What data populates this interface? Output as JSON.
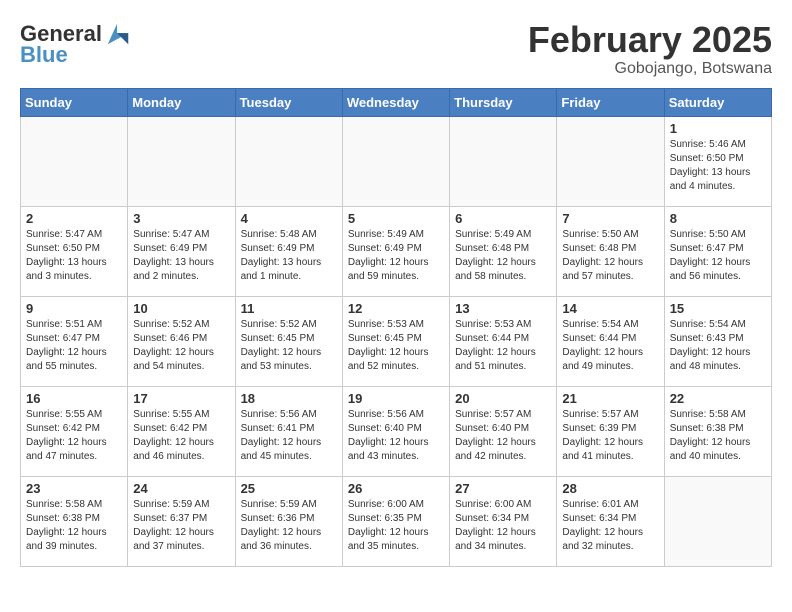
{
  "header": {
    "logo_general": "General",
    "logo_blue": "Blue",
    "month_title": "February 2025",
    "location": "Gobojango, Botswana"
  },
  "weekdays": [
    "Sunday",
    "Monday",
    "Tuesday",
    "Wednesday",
    "Thursday",
    "Friday",
    "Saturday"
  ],
  "weeks": [
    [
      {
        "day": "",
        "info": ""
      },
      {
        "day": "",
        "info": ""
      },
      {
        "day": "",
        "info": ""
      },
      {
        "day": "",
        "info": ""
      },
      {
        "day": "",
        "info": ""
      },
      {
        "day": "",
        "info": ""
      },
      {
        "day": "1",
        "info": "Sunrise: 5:46 AM\nSunset: 6:50 PM\nDaylight: 13 hours and 4 minutes."
      }
    ],
    [
      {
        "day": "2",
        "info": "Sunrise: 5:47 AM\nSunset: 6:50 PM\nDaylight: 13 hours and 3 minutes."
      },
      {
        "day": "3",
        "info": "Sunrise: 5:47 AM\nSunset: 6:49 PM\nDaylight: 13 hours and 2 minutes."
      },
      {
        "day": "4",
        "info": "Sunrise: 5:48 AM\nSunset: 6:49 PM\nDaylight: 13 hours and 1 minute."
      },
      {
        "day": "5",
        "info": "Sunrise: 5:49 AM\nSunset: 6:49 PM\nDaylight: 12 hours and 59 minutes."
      },
      {
        "day": "6",
        "info": "Sunrise: 5:49 AM\nSunset: 6:48 PM\nDaylight: 12 hours and 58 minutes."
      },
      {
        "day": "7",
        "info": "Sunrise: 5:50 AM\nSunset: 6:48 PM\nDaylight: 12 hours and 57 minutes."
      },
      {
        "day": "8",
        "info": "Sunrise: 5:50 AM\nSunset: 6:47 PM\nDaylight: 12 hours and 56 minutes."
      }
    ],
    [
      {
        "day": "9",
        "info": "Sunrise: 5:51 AM\nSunset: 6:47 PM\nDaylight: 12 hours and 55 minutes."
      },
      {
        "day": "10",
        "info": "Sunrise: 5:52 AM\nSunset: 6:46 PM\nDaylight: 12 hours and 54 minutes."
      },
      {
        "day": "11",
        "info": "Sunrise: 5:52 AM\nSunset: 6:45 PM\nDaylight: 12 hours and 53 minutes."
      },
      {
        "day": "12",
        "info": "Sunrise: 5:53 AM\nSunset: 6:45 PM\nDaylight: 12 hours and 52 minutes."
      },
      {
        "day": "13",
        "info": "Sunrise: 5:53 AM\nSunset: 6:44 PM\nDaylight: 12 hours and 51 minutes."
      },
      {
        "day": "14",
        "info": "Sunrise: 5:54 AM\nSunset: 6:44 PM\nDaylight: 12 hours and 49 minutes."
      },
      {
        "day": "15",
        "info": "Sunrise: 5:54 AM\nSunset: 6:43 PM\nDaylight: 12 hours and 48 minutes."
      }
    ],
    [
      {
        "day": "16",
        "info": "Sunrise: 5:55 AM\nSunset: 6:42 PM\nDaylight: 12 hours and 47 minutes."
      },
      {
        "day": "17",
        "info": "Sunrise: 5:55 AM\nSunset: 6:42 PM\nDaylight: 12 hours and 46 minutes."
      },
      {
        "day": "18",
        "info": "Sunrise: 5:56 AM\nSunset: 6:41 PM\nDaylight: 12 hours and 45 minutes."
      },
      {
        "day": "19",
        "info": "Sunrise: 5:56 AM\nSunset: 6:40 PM\nDaylight: 12 hours and 43 minutes."
      },
      {
        "day": "20",
        "info": "Sunrise: 5:57 AM\nSunset: 6:40 PM\nDaylight: 12 hours and 42 minutes."
      },
      {
        "day": "21",
        "info": "Sunrise: 5:57 AM\nSunset: 6:39 PM\nDaylight: 12 hours and 41 minutes."
      },
      {
        "day": "22",
        "info": "Sunrise: 5:58 AM\nSunset: 6:38 PM\nDaylight: 12 hours and 40 minutes."
      }
    ],
    [
      {
        "day": "23",
        "info": "Sunrise: 5:58 AM\nSunset: 6:38 PM\nDaylight: 12 hours and 39 minutes."
      },
      {
        "day": "24",
        "info": "Sunrise: 5:59 AM\nSunset: 6:37 PM\nDaylight: 12 hours and 37 minutes."
      },
      {
        "day": "25",
        "info": "Sunrise: 5:59 AM\nSunset: 6:36 PM\nDaylight: 12 hours and 36 minutes."
      },
      {
        "day": "26",
        "info": "Sunrise: 6:00 AM\nSunset: 6:35 PM\nDaylight: 12 hours and 35 minutes."
      },
      {
        "day": "27",
        "info": "Sunrise: 6:00 AM\nSunset: 6:34 PM\nDaylight: 12 hours and 34 minutes."
      },
      {
        "day": "28",
        "info": "Sunrise: 6:01 AM\nSunset: 6:34 PM\nDaylight: 12 hours and 32 minutes."
      },
      {
        "day": "",
        "info": ""
      }
    ]
  ]
}
